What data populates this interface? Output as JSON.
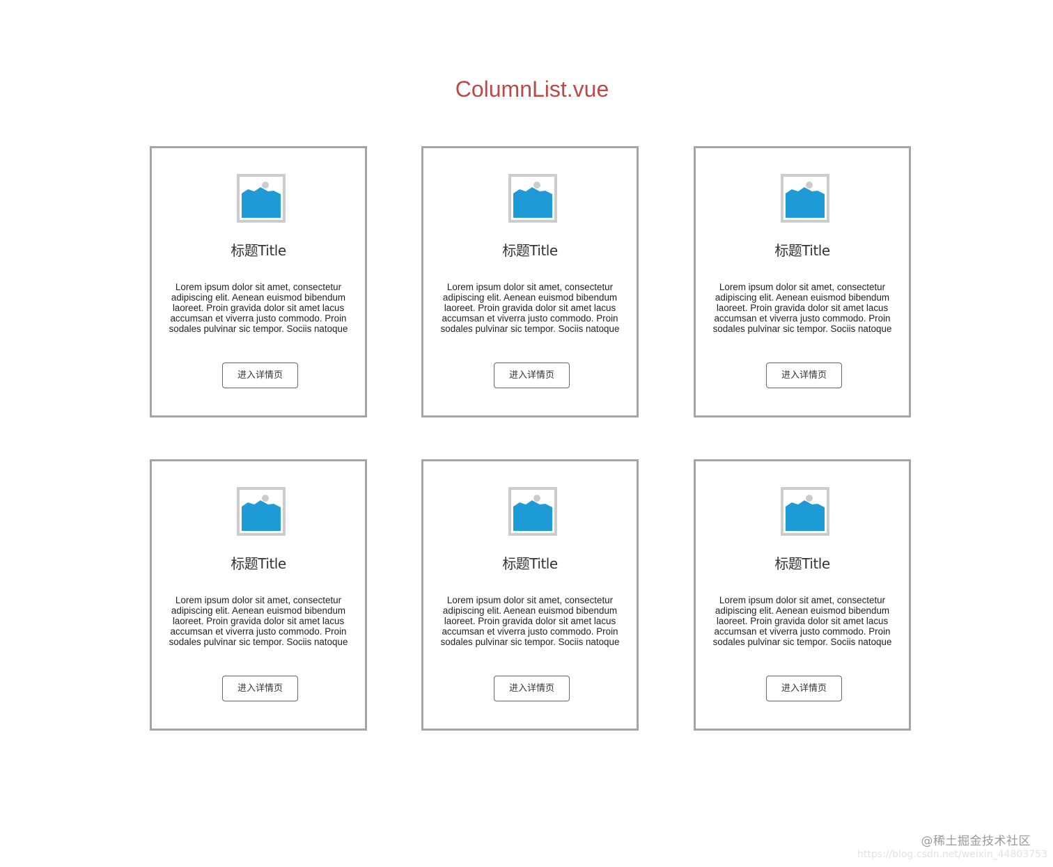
{
  "page": {
    "title": "ColumnList.vue"
  },
  "colors": {
    "title": "#b94a48",
    "card_border": "#a5a5a5",
    "image_frame": "#cccccc",
    "image_fill": "#1e9bd7"
  },
  "cards": [
    {
      "image_icon": "image-placeholder-icon",
      "title": "标题Title",
      "text": "Lorem ipsum dolor sit amet, consectetur adipiscing elit. Aenean euismod bibendum laoreet. Proin gravida dolor sit amet lacus accumsan et viverra justo commodo. Proin sodales pulvinar sic tempor. Sociis natoque",
      "button_label": "进入详情页"
    },
    {
      "image_icon": "image-placeholder-icon",
      "title": "标题Title",
      "text": "Lorem ipsum dolor sit amet, consectetur adipiscing elit. Aenean euismod bibendum laoreet. Proin gravida dolor sit amet lacus accumsan et viverra justo commodo. Proin sodales pulvinar sic tempor. Sociis natoque",
      "button_label": "进入详情页"
    },
    {
      "image_icon": "image-placeholder-icon",
      "title": "标题Title",
      "text": "Lorem ipsum dolor sit amet, consectetur adipiscing elit. Aenean euismod bibendum laoreet. Proin gravida dolor sit amet lacus accumsan et viverra justo commodo. Proin sodales pulvinar sic tempor. Sociis natoque",
      "button_label": "进入详情页"
    },
    {
      "image_icon": "image-placeholder-icon",
      "title": "标题Title",
      "text": "Lorem ipsum dolor sit amet, consectetur adipiscing elit. Aenean euismod bibendum laoreet. Proin gravida dolor sit amet lacus accumsan et viverra justo commodo. Proin sodales pulvinar sic tempor. Sociis natoque",
      "button_label": "进入详情页"
    },
    {
      "image_icon": "image-placeholder-icon",
      "title": "标题Title",
      "text": "Lorem ipsum dolor sit amet, consectetur adipiscing elit. Aenean euismod bibendum laoreet. Proin gravida dolor sit amet lacus accumsan et viverra justo commodo. Proin sodales pulvinar sic tempor. Sociis natoque",
      "button_label": "进入详情页"
    },
    {
      "image_icon": "image-placeholder-icon",
      "title": "标题Title",
      "text": "Lorem ipsum dolor sit amet, consectetur adipiscing elit. Aenean euismod bibendum laoreet. Proin gravida dolor sit amet lacus accumsan et viverra justo commodo. Proin sodales pulvinar sic tempor. Sociis natoque",
      "button_label": "进入详情页"
    }
  ],
  "watermark": {
    "line1": "@稀土掘金技术社区",
    "line2": "https://blog.csdn.net/weixin_44803753"
  }
}
